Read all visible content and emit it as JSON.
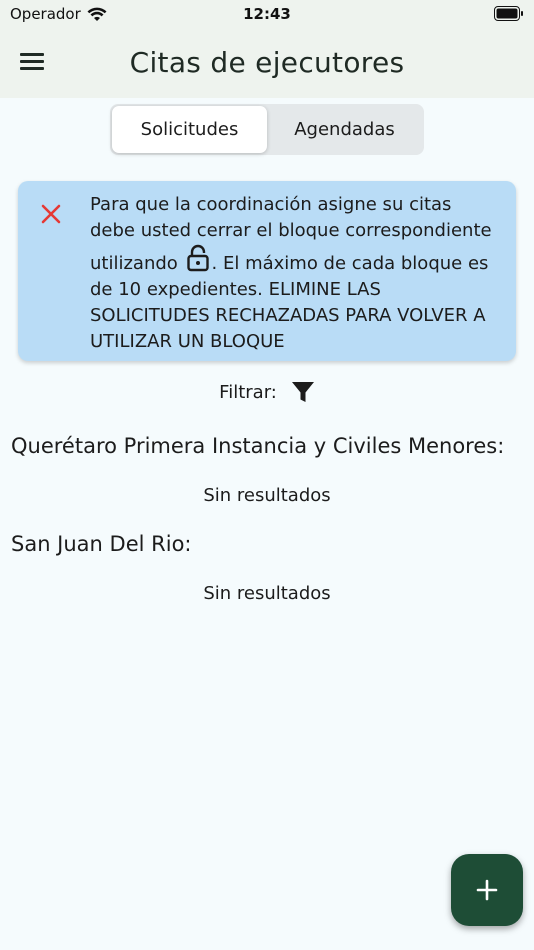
{
  "status_bar": {
    "carrier": "Operador",
    "time": "12:43"
  },
  "header": {
    "title": "Citas de ejecutores",
    "menu_icon": "hamburger-menu-icon"
  },
  "tabs": [
    {
      "label": "Solicitudes",
      "active": true
    },
    {
      "label": "Agendadas",
      "active": false
    }
  ],
  "alert": {
    "close_icon": "close-icon",
    "text_before_icon": "Para que la coordinación asigne su citas debe usted cerrar el bloque correspondiente utilizando",
    "inline_icon": "lock-open-icon",
    "text_after_icon": ". El máximo de cada bloque es de 10 expedientes. ELIMINE LAS SOLICITUDES RECHAZADAS PARA VOLVER A UTILIZAR UN BLOQUE",
    "background_color": "#b9dcf6",
    "close_color": "#e53935"
  },
  "filter": {
    "label": "Filtrar:",
    "icon": "filter-icon"
  },
  "sections": [
    {
      "title": "Querétaro Primera Instancia y Civiles Menores:",
      "empty_text": "Sin resultados"
    },
    {
      "title": "San Juan Del Rio:",
      "empty_text": "Sin resultados"
    }
  ],
  "fab": {
    "icon": "plus-icon",
    "color": "#1e4d36"
  }
}
